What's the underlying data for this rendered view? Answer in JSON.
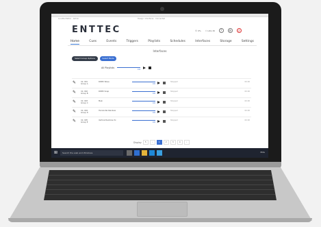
{
  "app": {
    "brand": "ENTTEC",
    "top_left": "Lucette Melton  ·  Admin",
    "top_center": "Design: Interfaces  ·  Connected",
    "header_small_left": "© 0%",
    "header_small_right": "⚇ LOG IN"
  },
  "nav": {
    "items": [
      "Home",
      "Cues",
      "Events",
      "Triggers",
      "Playlists",
      "Schedules",
      "Interfaces",
      "Storage",
      "Settings"
    ]
  },
  "page": {
    "title": "Interfaces",
    "button_dark": "Select Group Options",
    "button_blue": "Select Mode",
    "all_playlists_label": "All Playlists",
    "all_value": "100"
  },
  "rows": [
    {
      "id": "Int. 001",
      "sub": "Group A",
      "name": "RDMX Wave",
      "value": "100",
      "status": "Stopped",
      "time": "00:00"
    },
    {
      "id": "Int. 002",
      "sub": "Group B",
      "name": "RDMX Snap",
      "value": "100",
      "status": "Stopped",
      "time": "00:00"
    },
    {
      "id": "Int. 003",
      "sub": "Group C",
      "name": "Main",
      "value": "100",
      "status": "Stopped",
      "time": "00:00"
    },
    {
      "id": "Int. 004",
      "sub": "Group D",
      "name": "Horizontal Rainbow",
      "value": "100",
      "status": "Stopped",
      "time": "00:00"
    },
    {
      "id": "Int. 005",
      "sub": "Group E",
      "name": "Vertical Rainbow 3x",
      "value": "100",
      "status": "Stopped",
      "time": "00:00"
    }
  ],
  "pager": {
    "label": "Display",
    "per_page": "5",
    "pages": [
      "1",
      "2",
      "3",
      "4"
    ],
    "active": "1"
  },
  "taskbar": {
    "search_placeholder": "Search the web and Windows",
    "tray": "ENG"
  },
  "colors": {
    "accent": "#3a6fd1",
    "dark_button": "#333b48",
    "power": "#d33333"
  }
}
